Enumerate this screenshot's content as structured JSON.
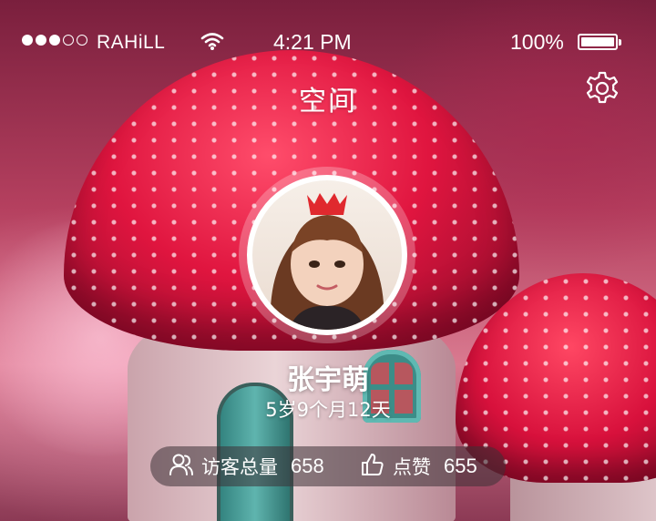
{
  "status_bar": {
    "signal_dots": [
      "on",
      "on",
      "on",
      "off",
      "off"
    ],
    "carrier": "RAHiLL",
    "time": "4:21 PM",
    "battery": "100%",
    "battery_level": 1.0
  },
  "header": {
    "title": "空间",
    "settings_icon": "gear-icon"
  },
  "profile": {
    "name": "张宇萌",
    "age": "5岁9个月12天"
  },
  "stats": {
    "visitors_icon": "users-icon",
    "visitors_label": "访客总量",
    "visitors_value": "658",
    "likes_icon": "thumbs-up-icon",
    "likes_label": "点赞",
    "likes_value": "655"
  },
  "colors": {
    "mushroom_red": "#e0153f",
    "door_teal": "#3c8d88",
    "stats_pill": "#3c3237"
  }
}
